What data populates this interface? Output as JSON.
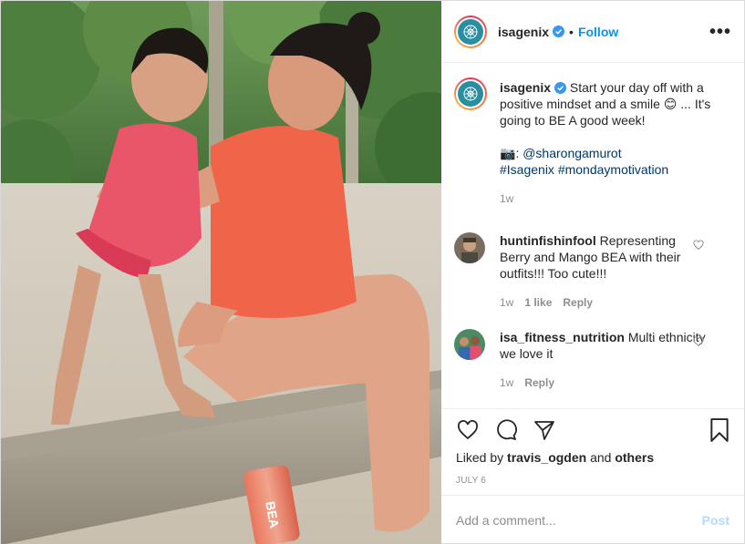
{
  "header": {
    "username": "isagenix",
    "separator": "•",
    "follow_label": "Follow",
    "more_icon": "•••"
  },
  "caption": {
    "username": "isagenix",
    "text_1": "Start your day off with a positive mindset and a smile",
    "emoji": "😊",
    "text_2": "... It's going to BE A good week!",
    "camera_emoji": "📷",
    "colon": ":",
    "mention": "@sharongamurot",
    "hashtags": "#Isagenix #mondaymotivation",
    "time": "1w"
  },
  "comments": [
    {
      "username": "huntinfishinfool",
      "text": "Representing Berry and Mango BEA with their outfits!!! Too cute!!!",
      "time": "1w",
      "likes": "1 like",
      "reply": "Reply"
    },
    {
      "username": "isa_fitness_nutrition",
      "text": "Multi ethnicity we love it",
      "time": "1w",
      "reply": "Reply"
    }
  ],
  "likes": {
    "prefix": "Liked by",
    "user": "travis_ogden",
    "middle": "and",
    "others": "others"
  },
  "date": "JULY 6",
  "add_comment": {
    "placeholder": "Add a comment...",
    "post_label": "Post"
  },
  "photo": {
    "can_label": "BEA"
  },
  "colors": {
    "accent": "#0095f6",
    "brand": "#2a8ea0",
    "text": "#262626",
    "muted": "#8e8e8e"
  },
  "icons": [
    "verified-icon",
    "more-icon",
    "heart-icon",
    "comment-icon",
    "share-icon",
    "bookmark-icon"
  ]
}
